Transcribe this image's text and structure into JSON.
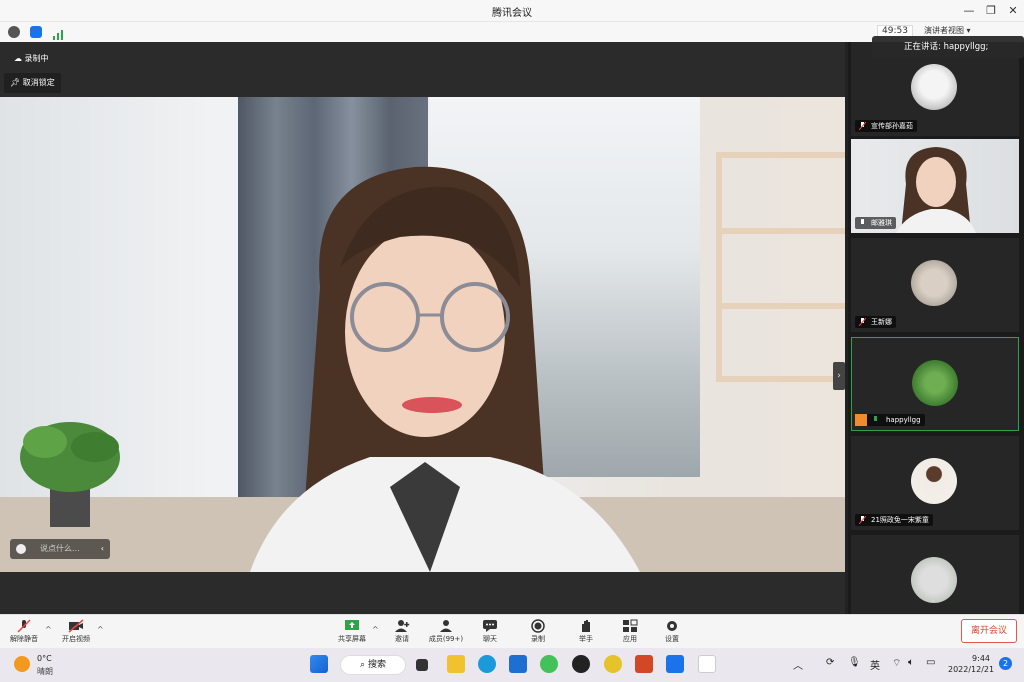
{
  "window": {
    "title": "腾讯会议",
    "minimize": "—",
    "restore": "❐",
    "close": "✕"
  },
  "infobar": {
    "timer": "49:53",
    "view_mode": "演讲者视图 ▾"
  },
  "stage": {
    "recording_label": "录制中",
    "unpin_label": "取消锁定",
    "chat_placeholder": "说点什么...",
    "chat_collapse": "‹",
    "speaking_now": "正在讲话: happyllgg;"
  },
  "participants": [
    {
      "name": "宣传部孙嘉茹",
      "mic": "muted"
    },
    {
      "name": "邮雅琪",
      "mic": "on"
    },
    {
      "name": "王新娜",
      "mic": "muted"
    },
    {
      "name": "happyllgg",
      "mic": "on",
      "host": true
    },
    {
      "name": "21照政免一宋紫童",
      "mic": "muted"
    },
    {
      "name": "",
      "mic": ""
    }
  ],
  "side_collapse": "›",
  "toolbar": {
    "unmute": "解除静音",
    "start_video": "开启视频",
    "share_screen": "共享屏幕",
    "invite": "邀请",
    "members": "成员(99+)",
    "chat": "聊天",
    "record": "录制",
    "raise_hand": "举手",
    "apps": "应用",
    "settings": "设置",
    "leave": "离开会议",
    "caret": "^"
  },
  "taskbar": {
    "weather_temp": "0°C",
    "weather_desc": "晴朗",
    "search_label": "⌕ 搜索",
    "ime": "英",
    "time": "9:44",
    "date": "2022/12/21",
    "notifications": "2"
  },
  "colors": {
    "accent_green": "#2fa34a",
    "leave_red": "#d84434",
    "toolbar_bg": "#f5f5f5",
    "stage_bg": "#2b2b2b"
  }
}
